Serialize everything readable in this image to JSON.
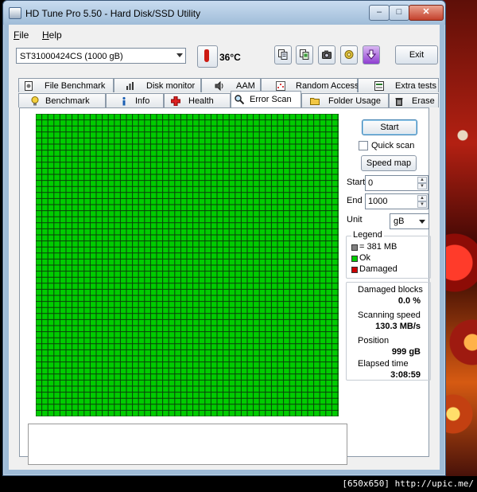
{
  "window": {
    "title": "HD Tune Pro 5.50 - Hard Disk/SSD Utility",
    "controls": {
      "minimize": "–",
      "maximize": "□",
      "close": "✕"
    }
  },
  "menu": {
    "file": {
      "label": "File",
      "mnemonic": "F",
      "rest": "ile"
    },
    "help": {
      "label": "Help",
      "mnemonic": "H",
      "rest": "elp"
    }
  },
  "toolbar": {
    "drive": "ST31000424CS (1000 gB)",
    "temperature": "36°C",
    "icons": [
      "copy-info-icon",
      "copy-screenshot-icon",
      "camera-icon",
      "options-icon",
      "save-icon"
    ],
    "exit_label": "Exit"
  },
  "tabs_top": [
    {
      "label": "File Benchmark",
      "icon": "file-benchmark-icon"
    },
    {
      "label": "Disk monitor",
      "icon": "disk-monitor-icon"
    },
    {
      "label": "AAM",
      "icon": "speaker-icon"
    },
    {
      "label": "Random Access",
      "icon": "random-access-icon"
    },
    {
      "label": "Extra tests",
      "icon": "extra-tests-icon"
    }
  ],
  "tabs_bottom": [
    {
      "label": "Benchmark",
      "icon": "lightbulb-icon"
    },
    {
      "label": "Info",
      "icon": "info-icon"
    },
    {
      "label": "Health",
      "icon": "health-cross-icon"
    },
    {
      "label": "Error Scan",
      "icon": "magnifier-icon",
      "active": true
    },
    {
      "label": "Folder Usage",
      "icon": "folder-icon"
    },
    {
      "label": "Erase",
      "icon": "trash-icon"
    }
  ],
  "scan": {
    "start_button": "Start",
    "quick_scan": {
      "label": "Quick scan",
      "checked": false
    },
    "speed_map_button": "Speed map",
    "start_label": "Start",
    "start_value": "0",
    "end_label": "End",
    "end_value": "1000",
    "unit_label": "Unit",
    "unit_value": "gB",
    "block_status": "ok",
    "block_color": "#00cc00"
  },
  "legend": {
    "title": "Legend",
    "items": [
      {
        "label": "= 381 MB",
        "color": "#808080"
      },
      {
        "label": "Ok",
        "color": "#00cc00"
      },
      {
        "label": "Damaged",
        "color": "#cc0000"
      }
    ]
  },
  "stats": {
    "damaged_blocks": {
      "label": "Damaged blocks",
      "value": "0.0 %"
    },
    "scanning_speed": {
      "label": "Scanning speed",
      "value": "130.3 MB/s"
    },
    "position": {
      "label": "Position",
      "value": "999 gB"
    },
    "elapsed_time": {
      "label": "Elapsed time",
      "value": "3:08:59"
    }
  },
  "watermark": "[650x650] http://upic.me/"
}
